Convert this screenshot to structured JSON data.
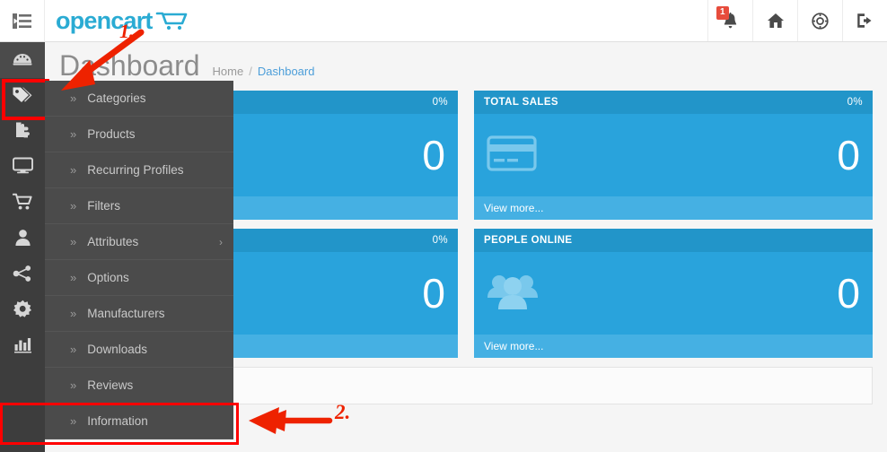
{
  "header": {
    "toggle_icon": "list-toggle-icon",
    "logo_text": "opencart",
    "logo_cart_icon": "shopping-cart-icon",
    "icons": [
      {
        "name": "notification-bell-icon",
        "badge": "1"
      },
      {
        "name": "home-icon",
        "badge": ""
      },
      {
        "name": "help-lifebuoy-icon",
        "badge": ""
      },
      {
        "name": "logout-icon",
        "badge": ""
      }
    ]
  },
  "sidebar": {
    "items": [
      {
        "name": "dashboard",
        "icon": "dashboard-gauge-icon",
        "active": true,
        "highlight": false
      },
      {
        "name": "catalog",
        "icon": "tags-icon",
        "active": false,
        "highlight": true
      },
      {
        "name": "extensions",
        "icon": "puzzle-piece-icon",
        "active": false,
        "highlight": false
      },
      {
        "name": "design",
        "icon": "monitor-icon",
        "active": false,
        "highlight": false
      },
      {
        "name": "sales",
        "icon": "shopping-cart-icon",
        "active": false,
        "highlight": false
      },
      {
        "name": "customers",
        "icon": "user-icon",
        "active": false,
        "highlight": false
      },
      {
        "name": "marketing",
        "icon": "share-nodes-icon",
        "active": false,
        "highlight": false
      },
      {
        "name": "system",
        "icon": "gear-icon",
        "active": false,
        "highlight": false
      },
      {
        "name": "reports",
        "icon": "bar-chart-icon",
        "active": false,
        "highlight": false
      }
    ]
  },
  "page": {
    "title": "Dashboard",
    "breadcrumb": [
      {
        "label": "Home",
        "current": false
      },
      {
        "label": "Dashboard",
        "current": true
      }
    ],
    "breadcrumb_separator": "/"
  },
  "tiles": [
    {
      "title": "",
      "percent": "0%",
      "value": "0",
      "view_more": "",
      "icon": "",
      "has_footer": true,
      "obscured": true
    },
    {
      "title": "TOTAL SALES",
      "percent": "0%",
      "value": "0",
      "view_more": "View more...",
      "icon": "credit-card-icon",
      "has_footer": true,
      "obscured": false
    },
    {
      "title": "",
      "percent": "0%",
      "value": "0",
      "view_more": "",
      "icon": "",
      "has_footer": true,
      "obscured": true
    },
    {
      "title": "PEOPLE ONLINE",
      "percent": "",
      "value": "0",
      "view_more": "View more...",
      "icon": "people-group-icon",
      "has_footer": true,
      "obscured": false
    }
  ],
  "dropdown": {
    "items": [
      {
        "label": "Categories",
        "has_submenu": false,
        "highlight": false
      },
      {
        "label": "Products",
        "has_submenu": false,
        "highlight": false
      },
      {
        "label": "Recurring Profiles",
        "has_submenu": false,
        "highlight": false
      },
      {
        "label": "Filters",
        "has_submenu": false,
        "highlight": false
      },
      {
        "label": "Attributes",
        "has_submenu": true,
        "highlight": false
      },
      {
        "label": "Options",
        "has_submenu": false,
        "highlight": false
      },
      {
        "label": "Manufacturers",
        "has_submenu": false,
        "highlight": false
      },
      {
        "label": "Downloads",
        "has_submenu": false,
        "highlight": false
      },
      {
        "label": "Reviews",
        "has_submenu": false,
        "highlight": false
      },
      {
        "label": "Information",
        "has_submenu": false,
        "highlight": true
      }
    ],
    "chevron": "»",
    "submenu_arrow": "›"
  },
  "annotations": {
    "color": "#ee2200",
    "step1_label": "1.",
    "step2_label": "2."
  }
}
